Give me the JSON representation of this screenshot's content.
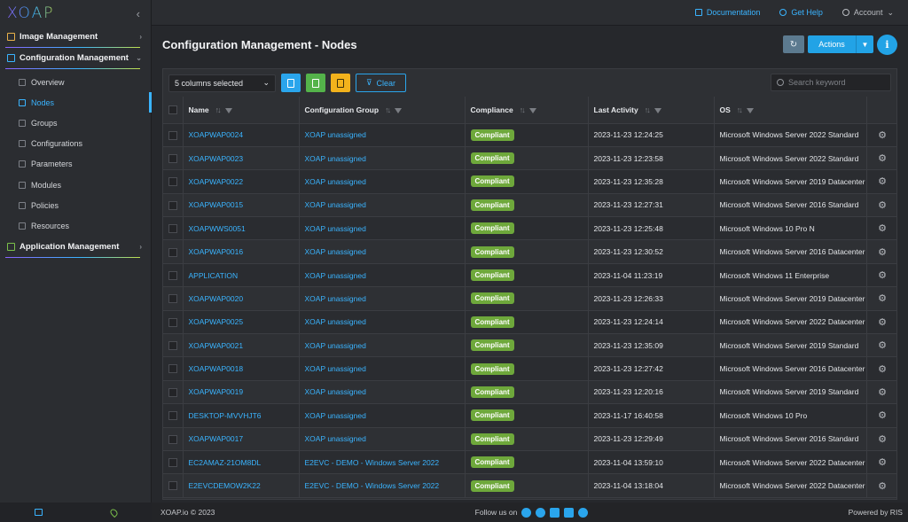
{
  "app": {
    "logo_text": "XOAP"
  },
  "colors": {
    "accent": "#22a3e6",
    "compliant": "#6ea83b",
    "background": "#26282c"
  },
  "topbar": {
    "documentation": "Documentation",
    "get_help": "Get Help",
    "account": "Account"
  },
  "sidebar": {
    "sections": [
      {
        "label": "Image Management",
        "icon": "image-icon",
        "expanded": false
      },
      {
        "label": "Configuration Management",
        "icon": "config-icon",
        "expanded": true
      },
      {
        "label": "Application Management",
        "icon": "app-icon",
        "expanded": false
      }
    ],
    "items": [
      {
        "label": "Overview",
        "icon": "overview-icon"
      },
      {
        "label": "Nodes",
        "icon": "nodes-icon",
        "active": true
      },
      {
        "label": "Groups",
        "icon": "groups-icon"
      },
      {
        "label": "Configurations",
        "icon": "gear-icon"
      },
      {
        "label": "Parameters",
        "icon": "list-icon"
      },
      {
        "label": "Modules",
        "icon": "module-icon"
      },
      {
        "label": "Policies",
        "icon": "policy-icon"
      },
      {
        "label": "Resources",
        "icon": "file-icon"
      }
    ]
  },
  "page": {
    "title": "Configuration Management - Nodes",
    "actions_label": "Actions",
    "info_label": "i"
  },
  "toolbar": {
    "columns_selected": "5 columns selected",
    "clear_label": "Clear",
    "search_placeholder": "Search keyword"
  },
  "table": {
    "headers": {
      "name": "Name",
      "group": "Configuration Group",
      "compliance": "Compliance",
      "activity": "Last Activity",
      "os": "OS"
    },
    "rows": [
      {
        "name": "XOAPWAP0024",
        "group": "XOAP unassigned",
        "compliance": "Compliant",
        "activity": "2023-11-23 12:24:25",
        "os": "Microsoft Windows Server 2022 Standard"
      },
      {
        "name": "XOAPWAP0023",
        "group": "XOAP unassigned",
        "compliance": "Compliant",
        "activity": "2023-11-23 12:23:58",
        "os": "Microsoft Windows Server 2022 Standard"
      },
      {
        "name": "XOAPWAP0022",
        "group": "XOAP unassigned",
        "compliance": "Compliant",
        "activity": "2023-11-23 12:35:28",
        "os": "Microsoft Windows Server 2019 Datacenter"
      },
      {
        "name": "XOAPWAP0015",
        "group": "XOAP unassigned",
        "compliance": "Compliant",
        "activity": "2023-11-23 12:27:31",
        "os": "Microsoft Windows Server 2016 Standard"
      },
      {
        "name": "XOAPWWS0051",
        "group": "XOAP unassigned",
        "compliance": "Compliant",
        "activity": "2023-11-23 12:25:48",
        "os": "Microsoft Windows 10 Pro N"
      },
      {
        "name": "XOAPWAP0016",
        "group": "XOAP unassigned",
        "compliance": "Compliant",
        "activity": "2023-11-23 12:30:52",
        "os": "Microsoft Windows Server 2016 Datacenter"
      },
      {
        "name": "APPLICATION",
        "group": "XOAP unassigned",
        "compliance": "Compliant",
        "activity": "2023-11-04 11:23:19",
        "os": "Microsoft Windows 11 Enterprise"
      },
      {
        "name": "XOAPWAP0020",
        "group": "XOAP unassigned",
        "compliance": "Compliant",
        "activity": "2023-11-23 12:26:33",
        "os": "Microsoft Windows Server 2019 Datacenter"
      },
      {
        "name": "XOAPWAP0025",
        "group": "XOAP unassigned",
        "compliance": "Compliant",
        "activity": "2023-11-23 12:24:14",
        "os": "Microsoft Windows Server 2022 Datacenter"
      },
      {
        "name": "XOAPWAP0021",
        "group": "XOAP unassigned",
        "compliance": "Compliant",
        "activity": "2023-11-23 12:35:09",
        "os": "Microsoft Windows Server 2019 Standard"
      },
      {
        "name": "XOAPWAP0018",
        "group": "XOAP unassigned",
        "compliance": "Compliant",
        "activity": "2023-11-23 12:27:42",
        "os": "Microsoft Windows Server 2016 Datacenter"
      },
      {
        "name": "XOAPWAP0019",
        "group": "XOAP unassigned",
        "compliance": "Compliant",
        "activity": "2023-11-23 12:20:16",
        "os": "Microsoft Windows Server 2019 Standard"
      },
      {
        "name": "DESKTOP-MVVHJT6",
        "group": "XOAP unassigned",
        "compliance": "Compliant",
        "activity": "2023-11-17 16:40:58",
        "os": "Microsoft Windows 10 Pro"
      },
      {
        "name": "XOAPWAP0017",
        "group": "XOAP unassigned",
        "compliance": "Compliant",
        "activity": "2023-11-23 12:29:49",
        "os": "Microsoft Windows Server 2016 Standard"
      },
      {
        "name": "EC2AMAZ-21OM8DL",
        "group": "E2EVC - DEMO - Windows Server 2022",
        "compliance": "Compliant",
        "activity": "2023-11-04 13:59:10",
        "os": "Microsoft Windows Server 2022 Datacenter"
      },
      {
        "name": "E2EVCDEMOW2K22",
        "group": "E2EVC - DEMO - Windows Server 2022",
        "compliance": "Compliant",
        "activity": "2023-11-04 13:18:04",
        "os": "Microsoft Windows Server 2022 Datacenter"
      }
    ]
  },
  "footer": {
    "copyright": "XOAP.io © 2023",
    "follow": "Follow us on",
    "powered": "Powered by RIS"
  }
}
